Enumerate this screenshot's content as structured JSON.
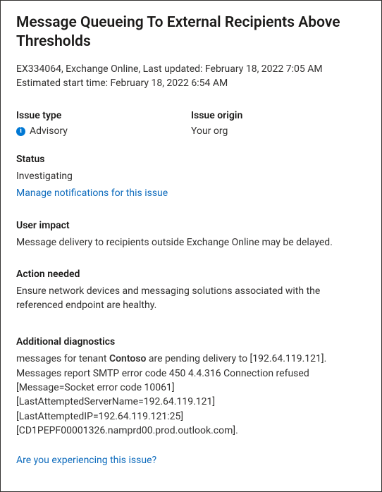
{
  "title": "Message Queueing To External Recipients Above Thresholds",
  "meta": {
    "line1": "EX334064, Exchange Online, Last updated: February 18, 2022 7:05 AM",
    "line2": "Estimated start time: February 18, 2022 6:54 AM"
  },
  "issueType": {
    "label": "Issue type",
    "value": "Advisory"
  },
  "issueOrigin": {
    "label": "Issue origin",
    "value": "Your org"
  },
  "status": {
    "label": "Status",
    "value": "Investigating",
    "manageLink": "Manage notifications for this issue"
  },
  "userImpact": {
    "label": "User impact",
    "value": "Message delivery to recipients outside Exchange Online may be delayed."
  },
  "actionNeeded": {
    "label": "Action needed",
    "value": "Ensure network devices and messaging solutions associated with the referenced endpoint are healthy."
  },
  "diagnostics": {
    "label": "Additional diagnostics",
    "pre": "messages for tenant ",
    "tenant": "Contoso",
    "post": " are pending delivery to [192.64.119.121]. Messages report SMTP error code 450 4.4.316 Connection refused [Message=Socket error code 10061] [LastAttemptedServerName=192.64.119.121] [LastAttemptedIP=192.64.119.121:25] [CD1PEPF00001326.namprd00.prod.outlook.com]."
  },
  "footer": {
    "link": "Are you experiencing this issue?"
  }
}
